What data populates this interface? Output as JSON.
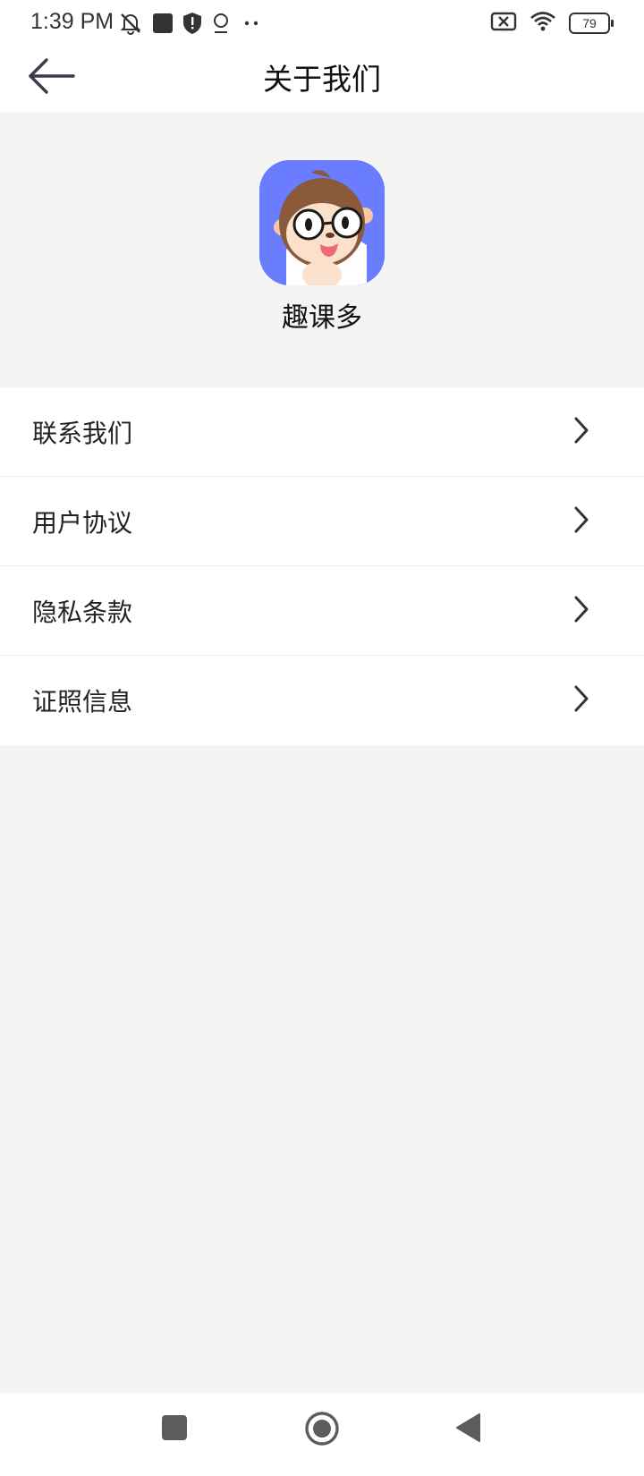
{
  "status_bar": {
    "time": "1:39 PM",
    "battery_level": "79",
    "icons": [
      "mute-icon",
      "app-square-icon",
      "shield-alert-icon",
      "location-icon",
      "more-dots-icon",
      "sim-disabled-icon",
      "wifi-icon",
      "battery-icon"
    ]
  },
  "header": {
    "title": "关于我们",
    "back_icon": "arrow-left-icon"
  },
  "app": {
    "name": "趣课多",
    "icon_color": "#6a7cff"
  },
  "menu": {
    "items": [
      {
        "label": "联系我们"
      },
      {
        "label": "用户协议"
      },
      {
        "label": "隐私条款"
      },
      {
        "label": "证照信息"
      }
    ],
    "chevron_icon": "chevron-right-icon"
  },
  "nav_bar": {
    "buttons": [
      "recent-apps-square-icon",
      "home-circle-icon",
      "back-triangle-icon"
    ]
  }
}
